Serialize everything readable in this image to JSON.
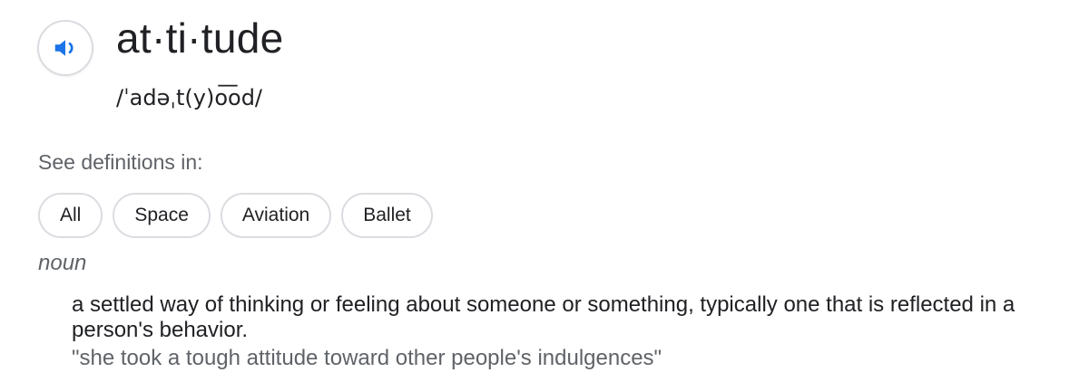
{
  "entry": {
    "headword": "at·ti·tude",
    "phonetic": "/ˈadəˌt(y)o͞od/"
  },
  "audio": {
    "icon": "speaker-icon",
    "accent_color": "#1a73e8"
  },
  "see_definitions": {
    "label": "See definitions in:",
    "chips": [
      {
        "label": "All"
      },
      {
        "label": "Space"
      },
      {
        "label": "Aviation"
      },
      {
        "label": "Ballet"
      }
    ]
  },
  "sense": {
    "part_of_speech": "noun",
    "definition": "a settled way of thinking or feeling about someone or something, typically one that is reflected in a person's behavior.",
    "example": "\"she took a tough attitude toward other people's indulgences\""
  }
}
